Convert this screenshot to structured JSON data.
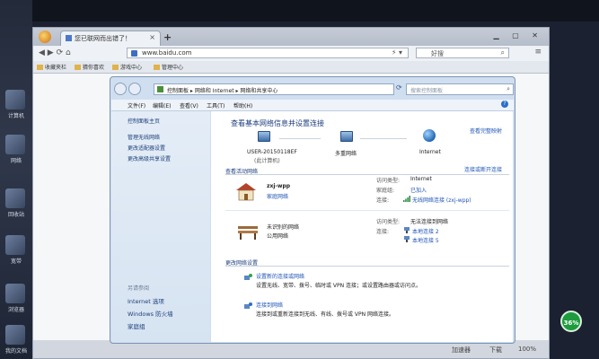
{
  "browser": {
    "tab_title": "您已联网而出错了！",
    "tab_close": "×",
    "new_tab": "+",
    "address": "www.baidu.com",
    "search_placeholder": "好搜",
    "favorites": [
      "收藏夹栏",
      "猜你喜欢",
      "游戏中心",
      "管理中心"
    ],
    "status": [
      "加速器",
      "下载",
      "100%"
    ]
  },
  "window": {
    "breadcrumb": "控制面板 ▸ 网络和 Internet ▸ 网络和共享中心",
    "search_placeholder": "搜索控制面板",
    "menu": [
      "文件(F)",
      "编辑(E)",
      "查看(V)",
      "工具(T)",
      "帮助(H)"
    ],
    "help": "?",
    "sidebar": {
      "links": [
        "控制面板主页",
        "管理无线网络",
        "更改适配器设置",
        "更改高级共享设置"
      ],
      "see_also_heading": "另请参阅",
      "see_also": [
        "Internet 选项",
        "Windows 防火墙",
        "家庭组"
      ]
    },
    "main": {
      "title": "查看基本网络信息并设置连接",
      "view_full_map": "查看完整映射",
      "computer_name": "USER-20150118EF",
      "computer_sub": "(此计算机)",
      "multi_network": "多重网络",
      "internet": "Internet",
      "active_heading": "查看活动网络",
      "connect_or_disconnect": "连接或断开连接",
      "net1_name": "zxj-wpp",
      "net1_type": "家庭网络",
      "net1_access_label": "访问类型:",
      "net1_access": "Internet",
      "net1_homegroup_label": "家庭组:",
      "net1_homegroup": "已加入",
      "net1_conn_label": "连接:",
      "net1_conn": "无线网络连接 (zxj-wpp)",
      "net2_name": "未识别的网络",
      "net2_type": "公用网络",
      "net2_access_label": "访问类型:",
      "net2_access": "无法连接到网络",
      "net2_conn_label": "连接:",
      "net2_conn_a": "本地连接 2",
      "net2_conn_b": "本地连接 5",
      "change_heading": "更改网络设置",
      "task1_link": "设置新的连接或网络",
      "task1_desc": "设置无线、宽带、拨号、临时或 VPN 连接；或设置路由器或访问点。",
      "task2_link": "连接到网络",
      "task2_desc": "连接到或重新连接到无线、有线、拨号或 VPN 网络连接。"
    }
  },
  "desktop": {
    "icon_labels": [
      "计算机",
      "网络",
      "回收站",
      "宽带",
      "浏览器",
      "我的文档"
    ],
    "badge": "36%"
  },
  "colors": {
    "link": "#1f55b6",
    "title": "#1b3c7d",
    "badge": "#1e9b3e"
  }
}
